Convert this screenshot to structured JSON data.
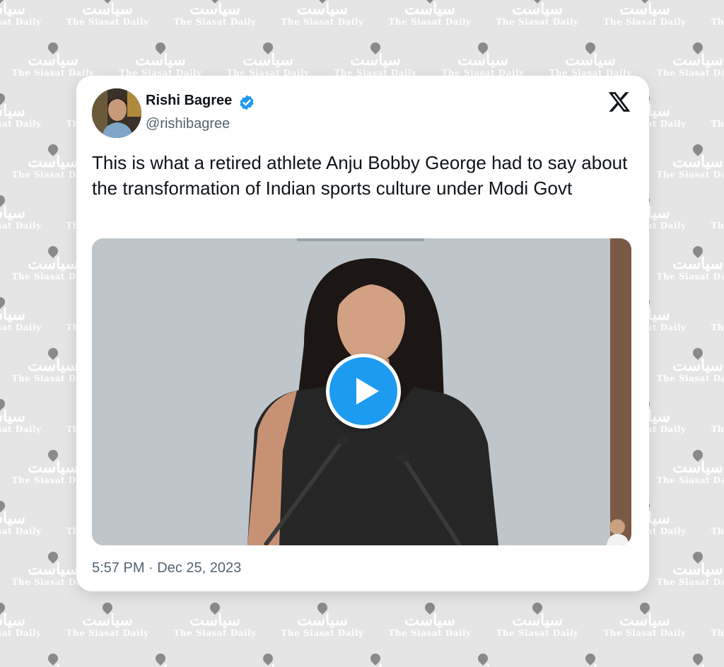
{
  "watermark": {
    "urdu": "سیاست",
    "english": "The Siasat Daily"
  },
  "tweet": {
    "author_name": "Rishi Bagree",
    "handle": "@rishibagree",
    "verified": true,
    "text": "This is what a retired athlete Anju Bobby George had to say about the transformation of Indian sports culture under Modi Govt",
    "timestamp": "5:57 PM · Dec 25, 2023",
    "media_type": "video"
  },
  "icons": {
    "verified": "verified-badge-icon",
    "platform": "x-logo-icon",
    "play": "play-icon"
  },
  "colors": {
    "accent": "#1d9bf0",
    "text_primary": "#0f1419",
    "text_secondary": "#536471",
    "background": "#e5e5e5"
  }
}
